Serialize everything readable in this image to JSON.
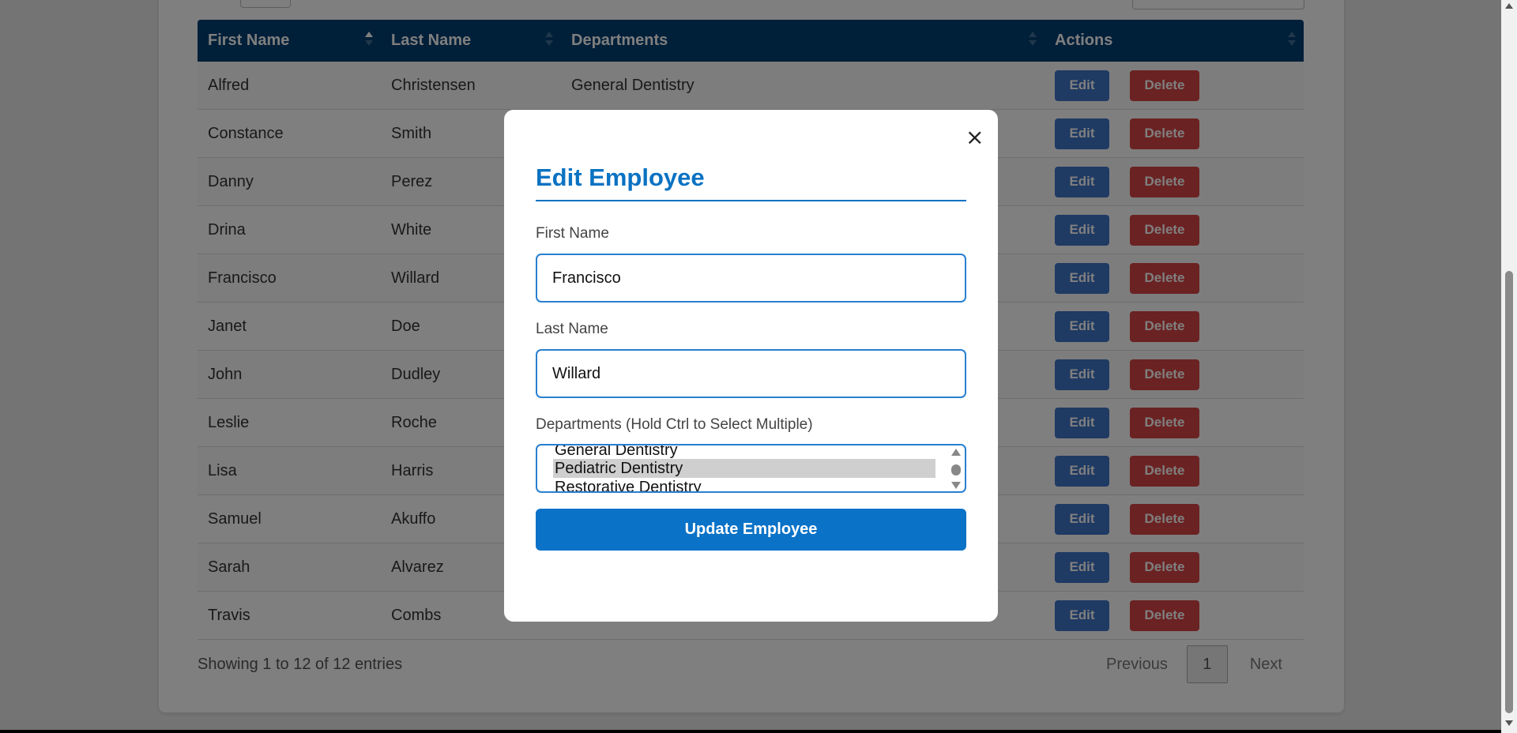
{
  "table": {
    "headers": [
      "First Name",
      "Last Name",
      "Departments",
      "Actions"
    ],
    "rows": [
      {
        "first": "Alfred",
        "last": "Christensen",
        "dept": "General Dentistry"
      },
      {
        "first": "Constance",
        "last": "Smith",
        "dept": ""
      },
      {
        "first": "Danny",
        "last": "Perez",
        "dept": ""
      },
      {
        "first": "Drina",
        "last": "White",
        "dept": ""
      },
      {
        "first": "Francisco",
        "last": "Willard",
        "dept": ""
      },
      {
        "first": "Janet",
        "last": "Doe",
        "dept": ""
      },
      {
        "first": "John",
        "last": "Dudley",
        "dept": ""
      },
      {
        "first": "Leslie",
        "last": "Roche",
        "dept": ""
      },
      {
        "first": "Lisa",
        "last": "Harris",
        "dept": ""
      },
      {
        "first": "Samuel",
        "last": "Akuffo",
        "dept": ""
      },
      {
        "first": "Sarah",
        "last": "Alvarez",
        "dept": ""
      },
      {
        "first": "Travis",
        "last": "Combs",
        "dept": ""
      }
    ],
    "edit_label": "Edit",
    "delete_label": "Delete",
    "sort_active_column": "First Name"
  },
  "footer": {
    "info": "Showing 1 to 12 of 12 entries",
    "previous": "Previous",
    "page": "1",
    "next": "Next"
  },
  "modal": {
    "close": "×",
    "title": "Edit Employee",
    "first_name_label": "First Name",
    "first_name_value": "Francisco",
    "last_name_label": "Last Name",
    "last_name_value": "Willard",
    "departments_label": "Departments (Hold Ctrl to Select Multiple)",
    "departments_options": [
      {
        "label": "General Dentistry",
        "selected": false
      },
      {
        "label": "Pediatric Dentistry",
        "selected": true
      },
      {
        "label": "Restorative Dentistry",
        "selected": false
      }
    ],
    "submit": "Update Employee"
  },
  "colors": {
    "header_bg": "#003f73",
    "accent": "#0a72c2",
    "edit_button": "#3f75c7",
    "delete_button": "#d64545",
    "overlay": "rgba(0,0,0,0.5)"
  }
}
